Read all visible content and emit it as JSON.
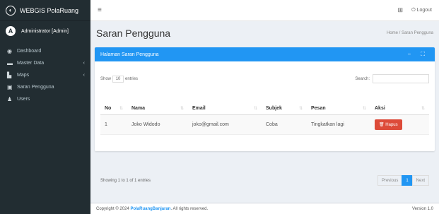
{
  "brand": {
    "title": "WEBGIS PolaRuang",
    "logo_icon": "globe-icon"
  },
  "user": {
    "name": "Administrator [Admin]",
    "avatar_letter": "A"
  },
  "sidebar": {
    "items": [
      {
        "label": "Dashboard",
        "icon": "dashboard-icon",
        "glyph": "◉",
        "chevron": ""
      },
      {
        "label": "Master Data",
        "icon": "folder-icon",
        "glyph": "▬",
        "chevron": "‹"
      },
      {
        "label": "Maps",
        "icon": "chart-icon",
        "glyph": "▙",
        "chevron": "‹"
      },
      {
        "label": "Saran Pengguna",
        "icon": "comment-icon",
        "glyph": "▣",
        "chevron": ""
      },
      {
        "label": "Users",
        "icon": "users-icon",
        "glyph": "♟",
        "chevron": ""
      }
    ]
  },
  "topbar": {
    "menu_glyph": "≡",
    "grid_glyph": "⊞",
    "logout_label": "⏻ Logout"
  },
  "page": {
    "title": "Saran Pengguna",
    "breadcrumb": "Home / Saran Pengguna"
  },
  "card": {
    "title": "Halaman Saran Pengguna",
    "tools": "− ⛶"
  },
  "controls": {
    "show_text": "Show",
    "entries_value": "10",
    "entries_text": "entries",
    "search_label": "Search:"
  },
  "table": {
    "headers": [
      "No",
      "Nama",
      "Email",
      "Subjek",
      "Pesan",
      "Aksi"
    ],
    "rows": [
      {
        "no": "1",
        "nama": "Joko Widodo",
        "email": "joko@gmail.com",
        "subjek": "Coba",
        "pesan": "Tingkatkan lagi",
        "aksi": "🗑 Hapus"
      }
    ]
  },
  "footer_info": {
    "showing": "Showing 1 to 1 of 1 entries"
  },
  "pagination": {
    "prev": "Previous",
    "current": "1",
    "next": "Next"
  },
  "footer": {
    "copyright_prefix": "Copyright © 2024",
    "link": "PolaRuangBanjaran",
    "suffix": ". All rights reserved.",
    "version": "Version 1.0"
  },
  "colors": {
    "sidebar": "#222d32",
    "primary": "#2196f3",
    "danger": "#dd4b39"
  }
}
